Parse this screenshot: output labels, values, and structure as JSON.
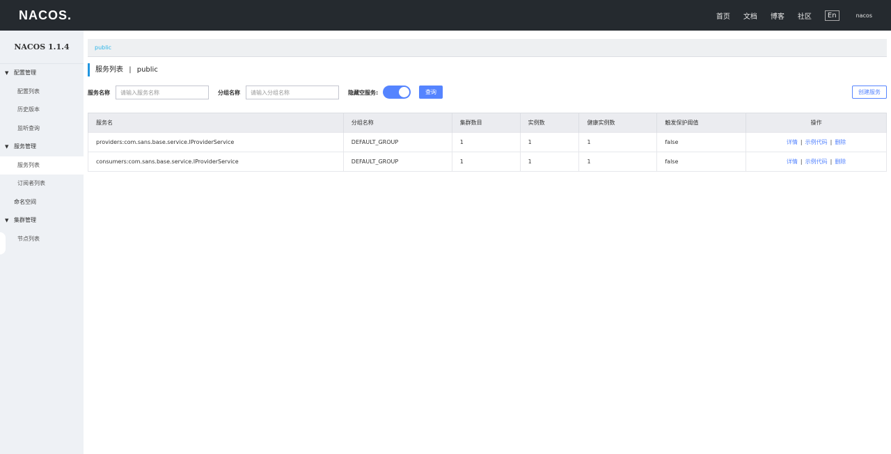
{
  "header": {
    "logo": "NACOS.",
    "nav": [
      "首页",
      "文档",
      "博客",
      "社区"
    ],
    "lang": "En",
    "user": "nacos"
  },
  "sidebar": {
    "version": "NACOS 1.1.4",
    "groups": [
      {
        "label": "配置管理",
        "items": [
          "配置列表",
          "历史版本",
          "监听查询"
        ]
      },
      {
        "label": "服务管理",
        "items": [
          "服务列表",
          "订阅者列表"
        ]
      },
      {
        "label": "命名空间"
      },
      {
        "label": "集群管理",
        "items": [
          "节点列表"
        ]
      }
    ]
  },
  "namespace": {
    "current": "public"
  },
  "page": {
    "title": "服务列表",
    "separator": "|",
    "namespace": "public"
  },
  "filters": {
    "service_name_label": "服务名称",
    "service_name_placeholder": "请输入服务名称",
    "group_name_label": "分组名称",
    "group_name_placeholder": "请输入分组名称",
    "hide_empty_label": "隐藏空服务:",
    "hide_empty_on": true,
    "query_button": "查询",
    "create_button": "创建服务"
  },
  "table": {
    "columns": [
      "服务名",
      "分组名称",
      "集群数目",
      "实例数",
      "健康实例数",
      "触发保护阈值",
      "操作"
    ],
    "rows": [
      [
        "providers:com.sans.base.service.IProviderService",
        "DEFAULT_GROUP",
        "1",
        "1",
        "1",
        "false"
      ],
      [
        "consumers:com.sans.base.service.IProviderService",
        "DEFAULT_GROUP",
        "1",
        "1",
        "1",
        "false"
      ]
    ],
    "actions": [
      "详情",
      "示例代码",
      "删除"
    ],
    "action_separator": "|"
  },
  "colors": {
    "topbar": "#252a2f",
    "accent": "#5584ff",
    "link": "#2ab4e8"
  }
}
